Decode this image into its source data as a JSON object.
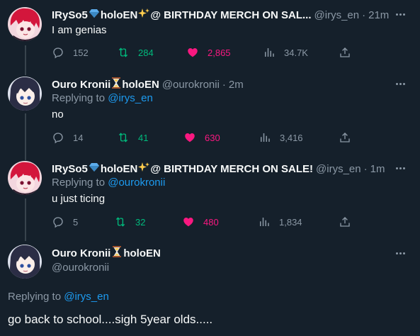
{
  "colors": {
    "background": "#15202b",
    "secondary_text": "#8b98a5",
    "link": "#1d9bf0",
    "retweet_green": "#00ba7c",
    "like_pink": "#f91880"
  },
  "tweets": [
    {
      "display_name": "IRySo5",
      "name_suffix": "holoEN",
      "name_extra": "@ BIRTHDAY MERCH ON SAL...",
      "handle": "@irys_en",
      "dot": "·",
      "time": "21m",
      "text": "I am genias",
      "replies": "152",
      "retweets": "284",
      "likes": "2,865",
      "views": "34.7K",
      "liked": true,
      "avatar_icon": "irys-avatar"
    },
    {
      "display_name": "Ouro Kronii",
      "name_suffix": "holoEN",
      "handle": "@ourokronii",
      "dot": "·",
      "time": "2m",
      "replying_prefix": "Replying to",
      "replying_to": "@irys_en",
      "text": "no",
      "replies": "14",
      "retweets": "41",
      "likes": "630",
      "views": "3,416",
      "liked": true,
      "avatar_icon": "kronii-avatar"
    },
    {
      "display_name": "IRySo5",
      "name_suffix": "holoEN",
      "name_extra": "@ BIRTHDAY MERCH ON SALE!",
      "handle": "@irys_en",
      "dot": "·",
      "time": "1m",
      "replying_prefix": "Replying to",
      "replying_to": "@ourokronii",
      "text": "u just ticing",
      "replies": "5",
      "retweets": "32",
      "likes": "480",
      "views": "1,834",
      "liked": true,
      "avatar_icon": "irys-avatar"
    }
  ],
  "main_tweet": {
    "display_name": "Ouro Kronii",
    "name_suffix": "holoEN",
    "handle": "@ourokronii",
    "replying_prefix": "Replying to",
    "replying_to": "@irys_en",
    "text": "go back to school....sigh 5year olds.....",
    "avatar_icon": "kronii-avatar"
  }
}
